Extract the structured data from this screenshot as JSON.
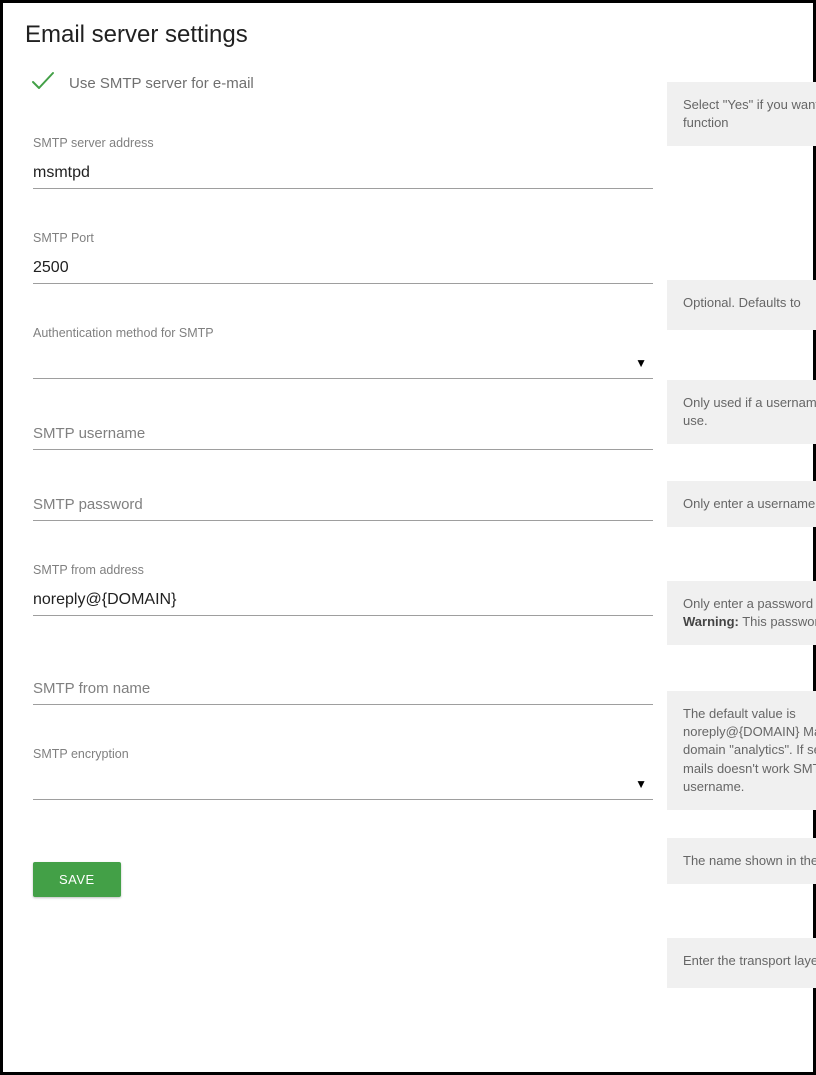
{
  "title": "Email server settings",
  "use_smtp_label": "Use SMTP server for e-mail",
  "fields": {
    "server_address": {
      "label": "SMTP server address",
      "value": "msmtpd"
    },
    "port": {
      "label": "SMTP Port",
      "value": "2500"
    },
    "auth_method": {
      "label": "Authentication method for SMTP",
      "value": ""
    },
    "username": {
      "placeholder": "SMTP username",
      "value": ""
    },
    "password": {
      "placeholder": "SMTP password",
      "value": ""
    },
    "from_address": {
      "label": "SMTP from address",
      "value": "noreply@{DOMAIN}"
    },
    "from_name": {
      "placeholder": "SMTP from name",
      "value": ""
    },
    "encryption": {
      "label": "SMTP encryption",
      "value": ""
    }
  },
  "save_label": "SAVE",
  "hints": {
    "use_smtp": "Select \"Yes\" if you want function",
    "port": "Optional. Defaults to",
    "auth_method": "Only used if a username to use.",
    "username": "Only enter a username",
    "password_line1": "Only enter a password",
    "password_warning_label": "Warning:",
    "password_line2": " This password it.",
    "from_address": "The default value is noreply@{DOMAIN} Matomo domain \"analytics\". If sending mails doesn't work SMTP username.",
    "from_name": "The name shown in the",
    "encryption": "Enter the transport layer"
  }
}
